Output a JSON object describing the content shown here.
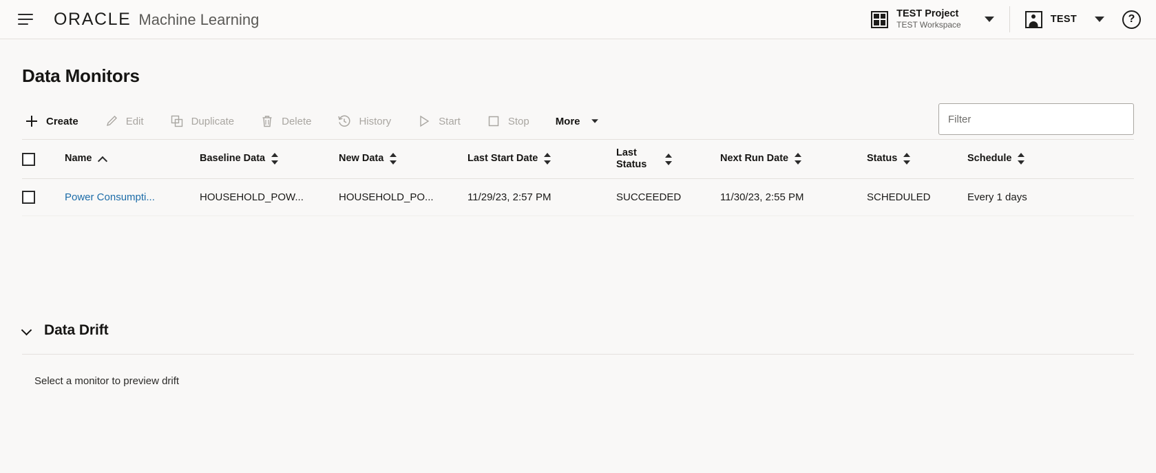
{
  "topbar": {
    "menu_icon": "hamburger-icon",
    "brand_oracle": "ORACLE",
    "brand_product": "Machine Learning",
    "project": {
      "icon": "grid-icon",
      "name": "TEST Project",
      "workspace": "TEST Workspace",
      "caret": "caret-down-icon"
    },
    "user": {
      "icon": "person-icon",
      "name": "TEST",
      "caret": "caret-down-icon"
    },
    "help": {
      "icon": "help-circle-icon",
      "glyph": "?"
    }
  },
  "page": {
    "title": "Data Monitors"
  },
  "toolbar": {
    "buttons": [
      {
        "label": "Create",
        "icon": "plus-icon",
        "enabled": true
      },
      {
        "label": "Edit",
        "icon": "pencil-icon",
        "enabled": false
      },
      {
        "label": "Duplicate",
        "icon": "copy-icon",
        "enabled": false
      },
      {
        "label": "Delete",
        "icon": "trash-icon",
        "enabled": false
      },
      {
        "label": "History",
        "icon": "clock-history-icon",
        "enabled": false
      },
      {
        "label": "Start",
        "icon": "play-icon",
        "enabled": false
      },
      {
        "label": "Stop",
        "icon": "stop-square-icon",
        "enabled": false
      },
      {
        "label": "More",
        "icon": "caret-down-icon",
        "enabled": true
      }
    ],
    "filter": {
      "value": "",
      "placeholder": "Filter"
    }
  },
  "table": {
    "select_all_checked": false,
    "columns": [
      {
        "label": "Name",
        "sort": "asc"
      },
      {
        "label": "Baseline Data",
        "sort": "both"
      },
      {
        "label": "New Data",
        "sort": "both"
      },
      {
        "label": "Last Start Date",
        "sort": "both"
      },
      {
        "label": "Last Status",
        "sort": "both"
      },
      {
        "label": "Next Run Date",
        "sort": "both"
      },
      {
        "label": "Status",
        "sort": "both"
      },
      {
        "label": "Schedule",
        "sort": "both"
      }
    ],
    "rows": [
      {
        "checked": false,
        "name": "Power Consumpti...",
        "baseline_data": "HOUSEHOLD_POW...",
        "new_data": "HOUSEHOLD_PO...",
        "last_start_date": "11/29/23, 2:57 PM",
        "last_status": "SUCCEEDED",
        "next_run_date": "11/30/23, 2:55 PM",
        "status": "SCHEDULED",
        "schedule": "Every 1 days"
      }
    ]
  },
  "data_drift": {
    "title": "Data Drift",
    "expanded": true,
    "message": "Select a monitor to preview drift"
  },
  "colors": {
    "link": "#1c6ca8",
    "background": "#f9f8f7",
    "topbar_bg": "#fbfaf9",
    "text": "#161513",
    "disabled_text": "#a9a6a1",
    "border": "#e4e1dd"
  }
}
